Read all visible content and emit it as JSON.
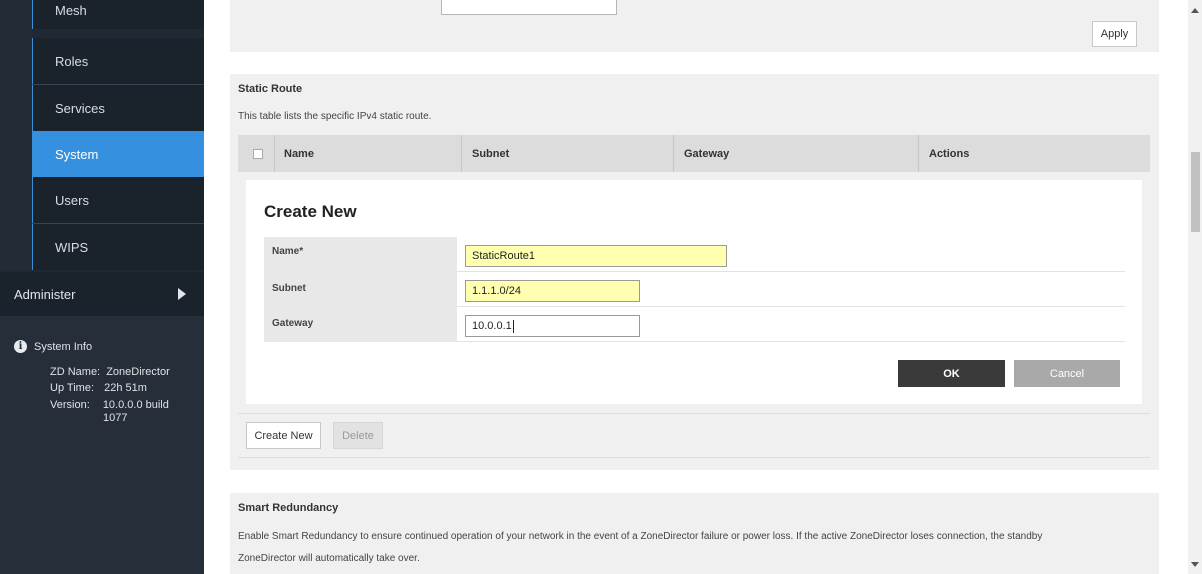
{
  "sidebar": {
    "items": [
      {
        "label": "Mesh"
      },
      {
        "label": "Roles"
      },
      {
        "label": "Services"
      },
      {
        "label": "System"
      },
      {
        "label": "Users"
      },
      {
        "label": "WIPS"
      }
    ],
    "active_item": "System",
    "administer_label": "Administer",
    "system_info": {
      "title": "System Info",
      "zd_name_label": "ZD Name:",
      "zd_name_value": "ZoneDirector",
      "uptime_label": "Up Time:",
      "uptime_value": "22h 51m",
      "version_label": "Version:",
      "version_value_line1": "10.0.0.0 build",
      "version_value_line2": "1077"
    }
  },
  "top_panel": {
    "apply_label": "Apply"
  },
  "static_route": {
    "title": "Static Route",
    "description": "This table lists the specific IPv4 static route.",
    "columns": [
      "Name",
      "Subnet",
      "Gateway",
      "Actions"
    ],
    "create_new": {
      "title": "Create New",
      "fields": [
        {
          "label": "Name*",
          "value": "StaticRoute1"
        },
        {
          "label": "Subnet",
          "value": "1.1.1.0/24"
        },
        {
          "label": "Gateway",
          "value": "10.0.0.1"
        }
      ],
      "ok_label": "OK",
      "cancel_label": "Cancel"
    },
    "create_new_button": "Create New",
    "delete_button": "Delete"
  },
  "smart_redundancy": {
    "title": "Smart Redundancy",
    "description_line1": "Enable Smart Redundancy to ensure continued operation of your network in the event of a ZoneDirector failure or power loss. If the active ZoneDirector loses connection, the standby",
    "description_line2": "ZoneDirector will automatically take over."
  },
  "colors": {
    "sidebar_bg": "#1f2833",
    "active_nav": "#3591e0",
    "panel_bg": "#f0f0f0",
    "input_highlight": "#ffffb0",
    "ok_button": "#3a3a3a",
    "cancel_button": "#a9a9a9"
  }
}
